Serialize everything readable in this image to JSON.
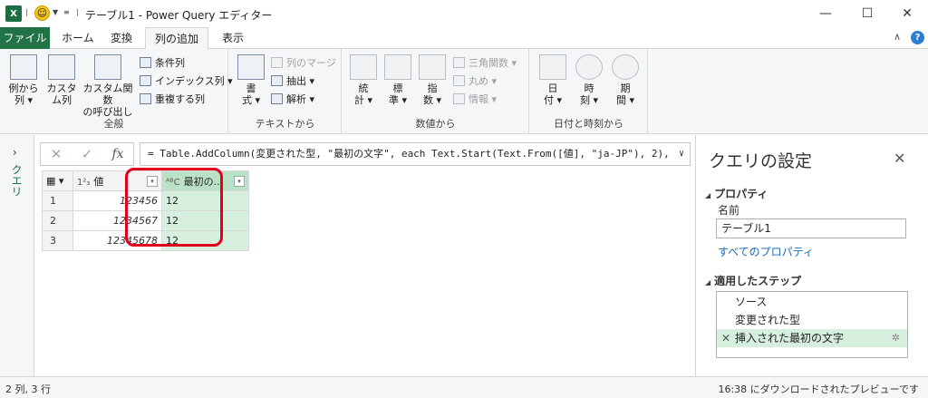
{
  "window": {
    "app_icon": "X",
    "title": "テーブル1 - Power Query エディター",
    "minimize": "—",
    "maximize": "☐",
    "close": "✕"
  },
  "tabs": [
    {
      "label": "ファイル"
    },
    {
      "label": "ホーム"
    },
    {
      "label": "変換"
    },
    {
      "label": "列の追加"
    },
    {
      "label": "表示"
    }
  ],
  "help": {
    "collapse": "∧",
    "question": "?"
  },
  "ribbon": {
    "general": {
      "group_label": "全般",
      "col_from_examples": "例から\n列 ▾",
      "custom_column": "カスタ\nム列",
      "invoke_custom_function": "カスタム関数\nの呼び出し",
      "conditional_column": "条件列",
      "index_column": "インデックス列 ▾",
      "duplicate_column": "重複する列"
    },
    "text": {
      "group_label": "テキストから",
      "format": "書\n式 ▾",
      "merge_columns": "列のマージ",
      "extract": "抽出 ▾",
      "parse": "解析 ▾"
    },
    "number": {
      "group_label": "数値から",
      "statistics": "統\n計 ▾",
      "standard": "標\n準 ▾",
      "scientific": "指\n数 ▾",
      "trigonometry": "三角関数 ▾",
      "rounding": "丸め ▾",
      "information": "情報 ▾"
    },
    "datetime": {
      "group_label": "日付と時刻から",
      "date": "日\n付 ▾",
      "time": "時\n刻 ▾",
      "duration": "期\n間 ▾"
    }
  },
  "queries_strip": {
    "arrow": "›",
    "label": "クエリ"
  },
  "formula": {
    "cancel": "✕",
    "commit": "✓",
    "fx": "fx",
    "text": "= Table.AddColumn(変更された型, \"最初の文字\", each Text.Start(Text.From([値], \"ja-JP\"), 2),",
    "expand": "∨"
  },
  "grid": {
    "col1_type": "1²₃",
    "col1_header": "値",
    "col2_type": "ᴬᴮC",
    "col2_header": "最初の...",
    "rows": [
      {
        "n": "1",
        "value": "123456",
        "first": "12"
      },
      {
        "n": "2",
        "value": "1234567",
        "first": "12"
      },
      {
        "n": "3",
        "value": "12345678",
        "first": "12"
      }
    ]
  },
  "settings": {
    "title": "クエリの設定",
    "close": "✕",
    "properties_header": "プロパティ",
    "name_label": "名前",
    "name_value": "テーブル1",
    "all_properties": "すべてのプロパティ",
    "steps_header": "適用したステップ",
    "steps": [
      {
        "label": "ソース"
      },
      {
        "label": "変更された型"
      },
      {
        "label": "挿入された最初の文字"
      }
    ],
    "gear": "✲"
  },
  "status": {
    "left": "2 列, 3 行",
    "right": "16:38 にダウンロードされたプレビューです"
  }
}
